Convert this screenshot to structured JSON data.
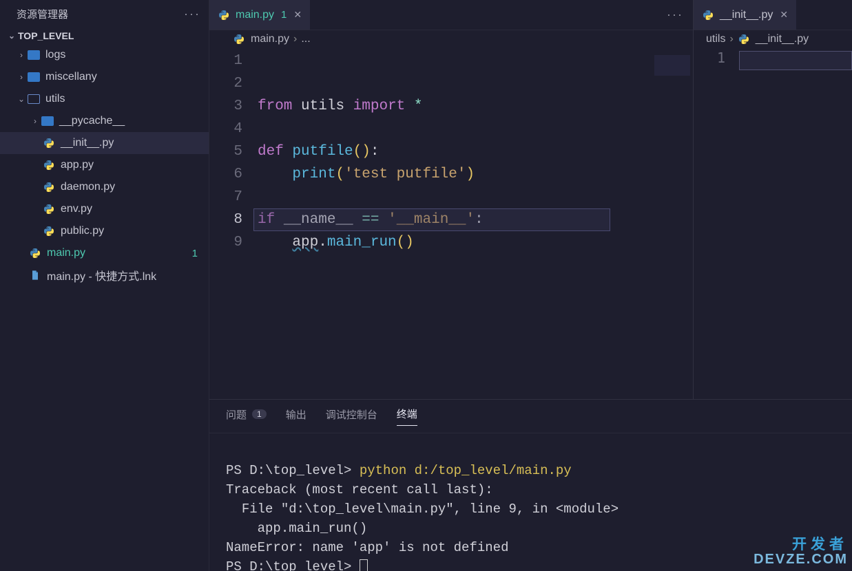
{
  "sidebar": {
    "title": "资源管理器",
    "root": "TOP_LEVEL",
    "items": [
      {
        "type": "folder",
        "name": "logs",
        "depth": 1,
        "expanded": false,
        "icon": "blue"
      },
      {
        "type": "folder",
        "name": "miscellany",
        "depth": 1,
        "expanded": false,
        "icon": "blue"
      },
      {
        "type": "folder",
        "name": "utils",
        "depth": 1,
        "expanded": true,
        "icon": "outline"
      },
      {
        "type": "folder",
        "name": "__pycache__",
        "depth": 2,
        "expanded": false,
        "icon": "blue"
      },
      {
        "type": "py",
        "name": "__init__.py",
        "depth": 2,
        "selected": true
      },
      {
        "type": "py",
        "name": "app.py",
        "depth": 2
      },
      {
        "type": "py",
        "name": "daemon.py",
        "depth": 2
      },
      {
        "type": "py",
        "name": "env.py",
        "depth": 2
      },
      {
        "type": "py",
        "name": "public.py",
        "depth": 2
      },
      {
        "type": "py",
        "name": "main.py",
        "depth": 1,
        "modified": true,
        "count": "1"
      },
      {
        "type": "doc",
        "name": "main.py - 快捷方式.lnk",
        "depth": 1
      }
    ]
  },
  "editor_main": {
    "tab": {
      "name": "main.py",
      "count": "1",
      "modified": true
    },
    "breadcrumb": {
      "file": "main.py",
      "rest": "..."
    },
    "lines": [
      "1",
      "2",
      "3",
      "4",
      "5",
      "6",
      "7",
      "8",
      "9"
    ],
    "code": {
      "l2_from": "from",
      "l2_utils": "utils",
      "l2_import": "import",
      "l2_star": "*",
      "l4_def": "def",
      "l4_fn": "putfile",
      "l4_par": "()",
      "l4_colon": ":",
      "l5_fn": "print",
      "l5_po": "(",
      "l5_str": "'test putfile'",
      "l5_pc": ")",
      "l7_if": "if",
      "l7_name": "__name__",
      "l7_eq": "==",
      "l7_str": "'__main__'",
      "l7_colon": ":",
      "l8_app": "app",
      "l8_dot": ".",
      "l8_fn": "main_run",
      "l8_par": "()"
    }
  },
  "editor_side": {
    "tab": {
      "name": "__init__.py"
    },
    "breadcrumb": {
      "folder": "utils",
      "file": "__init__.py"
    },
    "line1": "1"
  },
  "panel": {
    "tabs": {
      "problems": "问题",
      "problems_count": "1",
      "output": "输出",
      "debug": "调试控制台",
      "terminal": "终端"
    },
    "terminal": {
      "prompt1": "PS D:\\top_level> ",
      "cmd": "python d:/top_level/main.py",
      "lines": [
        "Traceback (most recent call last):",
        "  File \"d:\\top_level\\main.py\", line 9, in <module>",
        "    app.main_run()",
        "NameError: name 'app' is not defined"
      ],
      "prompt2": "PS D:\\top_level> "
    }
  },
  "watermark": {
    "row1": "开发者",
    "row2": "DEVZE.COM"
  }
}
